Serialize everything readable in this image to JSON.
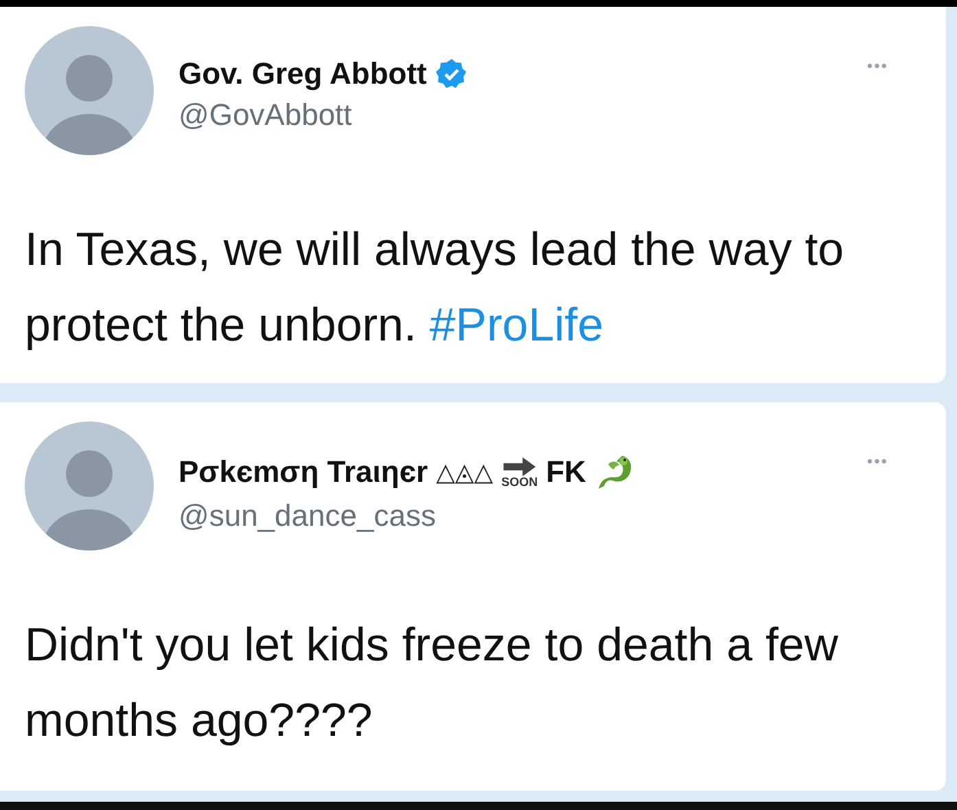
{
  "tweets": [
    {
      "name_parts": [
        {
          "kind": "text",
          "text": "Gov. Greg Abbott"
        },
        {
          "kind": "verified"
        }
      ],
      "handle": "@GovAbbott",
      "more": "•••",
      "text": "In Texas, we will always lead the way to protect the unborn.",
      "hashtag": "#ProLife"
    },
    {
      "name_parts": [
        {
          "kind": "text",
          "text": "Pσkєmση Traιηєr"
        },
        {
          "kind": "symbols",
          "text": "△◬△"
        },
        {
          "kind": "soon",
          "text": "SOON"
        },
        {
          "kind": "text",
          "text": "FK"
        },
        {
          "kind": "dragon"
        }
      ],
      "handle": "@sun_dance_cass",
      "more": "•••",
      "text": "Didn't you let kids freeze to death a few months ago????"
    }
  ]
}
